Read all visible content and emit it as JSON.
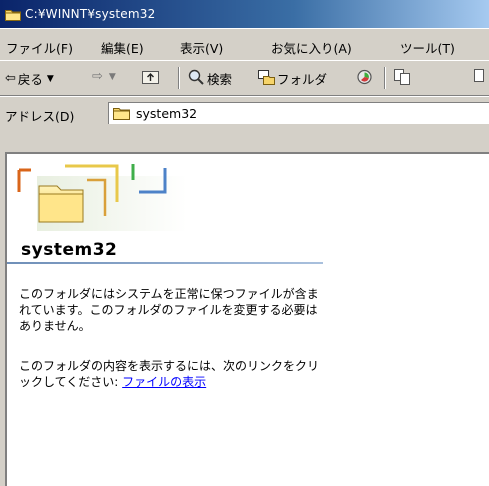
{
  "window": {
    "title": "C:¥WINNT¥system32"
  },
  "menu": [
    "ファイル(F)",
    "編集(E)",
    "表示(V)",
    "お気に入り(A)",
    "ツール(T)"
  ],
  "toolbar": {
    "back_label": "戻る",
    "search_label": "検索",
    "folders_label": "フォルダ"
  },
  "address": {
    "label": "アドレス(D)",
    "value": "system32"
  },
  "panel": {
    "title": "system32",
    "description": "このフォルダにはシステムを正常に保つファイルが含まれています。このフォルダのファイルを変更する必要はありません。",
    "link_text": "このフォルダの内容を表示するには、次のリンクをクリックしてください:",
    "link_label": "ファイルの表示"
  },
  "icons": {
    "title": "folder-icon",
    "address": "folder-icon",
    "panel": "folder-icon",
    "back": "back-arrow-icon",
    "forward": "forward-arrow-icon",
    "up": "up-folder-icon",
    "search": "search-icon",
    "folders": "folders-icon",
    "history": "history-icon",
    "move_to": "move-to-icon"
  },
  "colors": {
    "titlebar_start": "#0a246a",
    "titlebar_end": "#a6caf0",
    "chrome": "#d4d0c8",
    "link": "#0000ff",
    "panel_rule": "#6f8fb8"
  }
}
